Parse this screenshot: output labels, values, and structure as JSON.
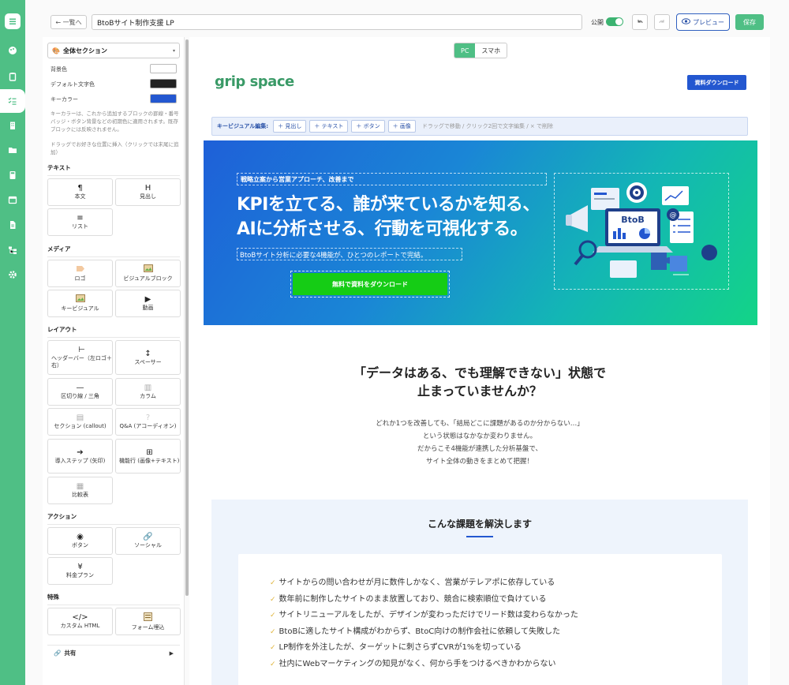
{
  "toolbar": {
    "back_label": "← 一覧へ",
    "page_title": "BtoBサイト制作支援 LP",
    "publish_label": "公開",
    "publish_on": true,
    "undo_icon": "undo-icon",
    "redo_icon": "redo-icon",
    "preview_label": "プレビュー",
    "save_label": "保存",
    "accent": "#4fbf85",
    "preview_color": "#2a52a8"
  },
  "rail": {
    "icons": [
      "menu-icon",
      "palette-icon",
      "clipboard-icon",
      "checklist-icon",
      "building-icon",
      "folder-icon",
      "calculator-icon",
      "calendar-icon",
      "document-icon",
      "sitemap-icon",
      "gear-icon"
    ],
    "active_index": 3
  },
  "panel": {
    "section_select": "全体セクション",
    "bg_label": "背景色",
    "text_color_label": "デフォルト文字色",
    "key_color_label": "キーカラー",
    "bg_color": "#ffffff",
    "text_color": "#222222",
    "key_color": "#2357d0",
    "key_note": "キーカラーは、これから追加するブロックの罫線・番号バッジ・ボタン背景などの初期色に適用されます。既存ブロックには反映されません。",
    "drag_note": "ドラッグでお好きな位置に挿入（クリックでは末尾に追加）",
    "categories": {
      "text": "テキスト",
      "media": "メディア",
      "layout": "レイアウト",
      "action": "アクション",
      "special": "特殊"
    },
    "blocks": {
      "body": "本文",
      "heading": "見出し",
      "list": "リスト",
      "logo": "ロゴ",
      "visual_block": "ビジュアルブロック",
      "key_visual": "キービジュアル",
      "video": "動画",
      "header_bar": "ヘッダーバー（左ロゴ＋右）",
      "spacer": "スペーサー",
      "divider": "区切り線 / 三角",
      "column": "カラム",
      "callout": "セクション (callout)",
      "qa": "Q&A (アコーディオン)",
      "steps": "導入ステップ (矢印)",
      "feature_row": "機能行 (画像+テキスト)",
      "compare": "比較表",
      "button": "ボタン",
      "social": "ソーシャル",
      "pricing": "料金プラン",
      "custom_html": "カスタム HTML",
      "form": "フォーム埋込"
    },
    "shared_label": "共有"
  },
  "canvas": {
    "device_pc": "PC",
    "device_sp": "スマホ",
    "logo_text": "grip space",
    "header_cta": "資料ダウンロード",
    "kv_bar": {
      "label": "キービジュアル編集:",
      "buttons": [
        "＋ 見出し",
        "＋ テキスト",
        "＋ ボタン",
        "＋ 画像"
      ],
      "hint": "ドラッグで移動 / クリック2回で文字編集 / × で削除"
    },
    "hero": {
      "eyebrow": "戦略立案から営業アプローチ、改善まで",
      "headline_1": "KPIを立てる、誰が来ているかを知る、",
      "headline_2": "AIに分析させる、行動を可視化する。",
      "sub": "BtoBサイト分析に必要な4機能が、ひとつのレポートで完結。",
      "cta": "無料で資料をダウンロード",
      "illustration_label": "BtoB"
    },
    "problem": {
      "title_1": "「データはある、でも理解できない」状態で",
      "title_2": "止まっていませんか？",
      "lines": [
        "どれか1つを改善しても、「結局どこに課題があるのか分からない…」",
        "という状態はなかなか変わりません。",
        "だからこそ4機能が連携した分析基盤で、",
        "サイト全体の動きをまとめて把握！"
      ]
    },
    "issues": {
      "title": "こんな課題を解決します",
      "items": [
        "サイトからの問い合わせが月に数件しかなく、営業がテレアポに依存している",
        "数年前に制作したサイトのまま放置しており、競合に検索順位で負けている",
        "サイトリニューアルをしたが、デザインが変わっただけでリード数は変わらなかった",
        "BtoBに適したサイト構成がわからず、BtoC向けの制作会社に依頼して失敗した",
        "LP制作を外注したが、ターゲットに刺さらずCVRが1%を切っている",
        "社内にWebマーケティングの知見がなく、何から手をつけるべきかわからない"
      ]
    }
  }
}
